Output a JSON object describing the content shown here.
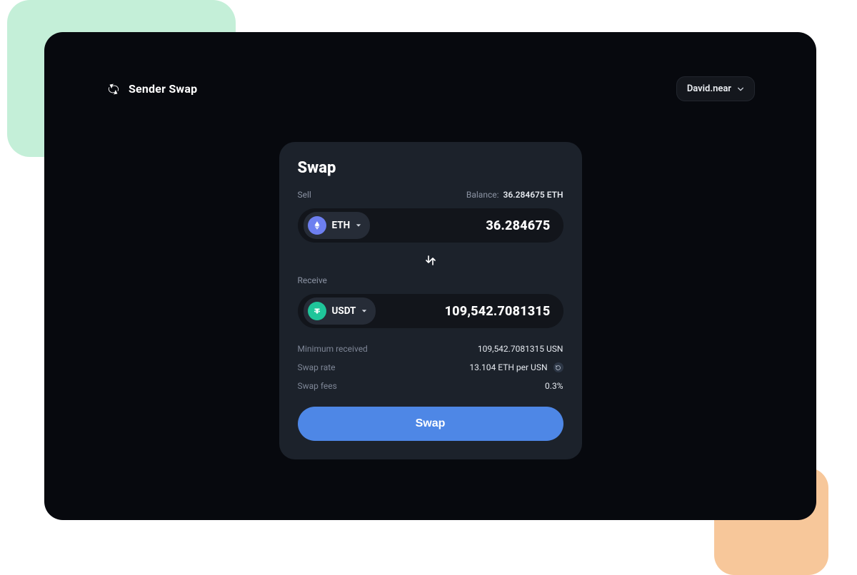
{
  "brand": {
    "title": "Sender Swap"
  },
  "account": {
    "label": "David.near"
  },
  "card": {
    "title": "Swap",
    "sell_label": "Sell",
    "balance_label": "Balance:",
    "balance_value": "36.284675 ETH",
    "sell_token": "ETH",
    "sell_amount": "36.284675",
    "receive_label": "Receive",
    "receive_token": "USDT",
    "receive_amount": "109,542.7081315",
    "min_received_label": "Minimum received",
    "min_received_value": "109,542.7081315 USN",
    "swap_rate_label": "Swap rate",
    "swap_rate_value": "13.104 ETH per USN",
    "swap_fees_label": "Swap fees",
    "swap_fees_value": "0.3%",
    "swap_button": "Swap"
  },
  "colors": {
    "accent": "#4e87e6",
    "eth_icon_bg": "#6d7ff0",
    "usdt_icon_bg": "#1fc59a"
  }
}
